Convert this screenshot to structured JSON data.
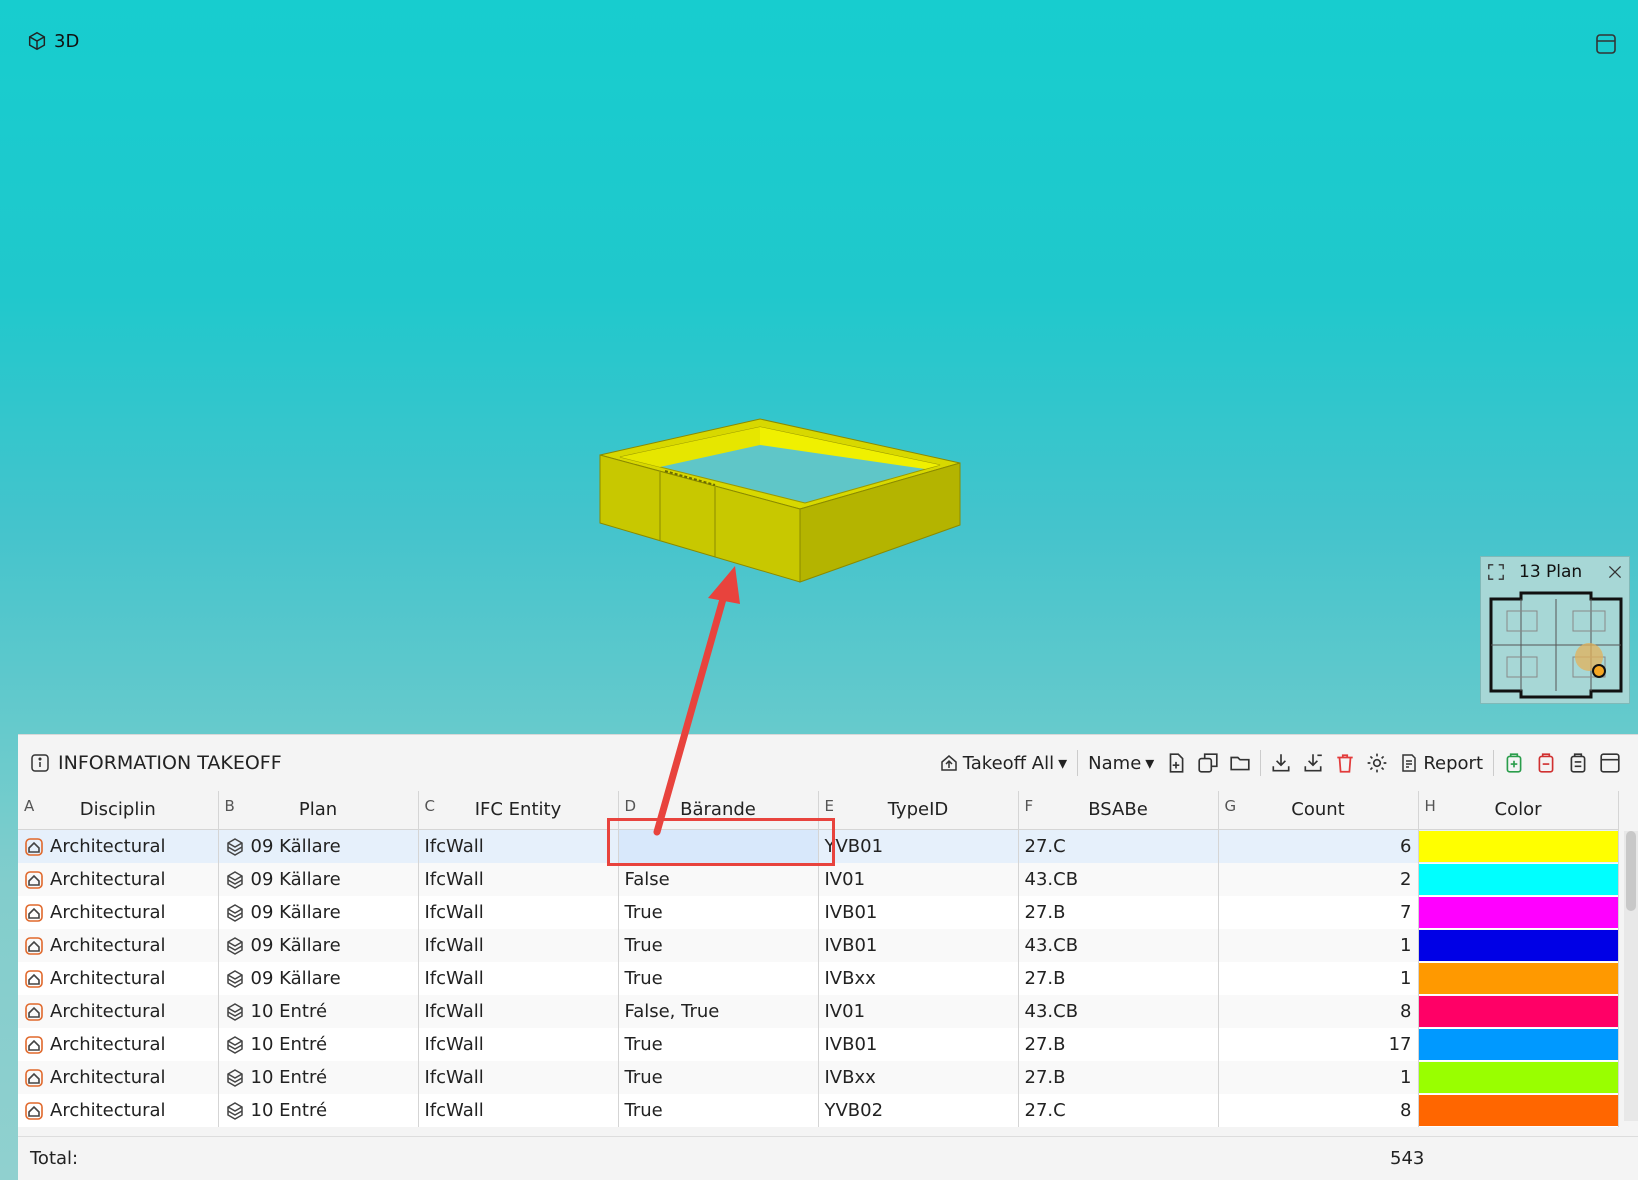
{
  "viewport": {
    "label": "3D",
    "background_top": "#17cdcf",
    "background_bottom": "#90d0cf"
  },
  "minimap": {
    "title": "13 Plan"
  },
  "panel": {
    "title": "INFORMATION TAKEOFF",
    "toolbar": {
      "takeoff_all": "Takeoff All",
      "name": "Name",
      "report": "Report"
    },
    "columns": [
      {
        "letter": "A",
        "label": "Disciplin"
      },
      {
        "letter": "B",
        "label": "Plan"
      },
      {
        "letter": "C",
        "label": "IFC Entity"
      },
      {
        "letter": "D",
        "label": "Bärande"
      },
      {
        "letter": "E",
        "label": "TypeID"
      },
      {
        "letter": "F",
        "label": "BSABe"
      },
      {
        "letter": "G",
        "label": "Count"
      },
      {
        "letter": "H",
        "label": "Color"
      }
    ],
    "rows": [
      {
        "disciplin": "Architectural",
        "plan": "09 Källare",
        "entity": "IfcWall",
        "barande": "",
        "typeid": "YVB01",
        "bsabe": "27.C",
        "count": "6",
        "color": "#ffff00"
      },
      {
        "disciplin": "Architectural",
        "plan": "09 Källare",
        "entity": "IfcWall",
        "barande": "False",
        "typeid": "IV01",
        "bsabe": "43.CB",
        "count": "2",
        "color": "#00ffff"
      },
      {
        "disciplin": "Architectural",
        "plan": "09 Källare",
        "entity": "IfcWall",
        "barande": "True",
        "typeid": "IVB01",
        "bsabe": "27.B",
        "count": "7",
        "color": "#ff00ff"
      },
      {
        "disciplin": "Architectural",
        "plan": "09 Källare",
        "entity": "IfcWall",
        "barande": "True",
        "typeid": "IVB01",
        "bsabe": "43.CB",
        "count": "1",
        "color": "#0000e6"
      },
      {
        "disciplin": "Architectural",
        "plan": "09 Källare",
        "entity": "IfcWall",
        "barande": "True",
        "typeid": "IVBxx",
        "bsabe": "27.B",
        "count": "1",
        "color": "#ff9900"
      },
      {
        "disciplin": "Architectural",
        "plan": "10 Entré",
        "entity": "IfcWall",
        "barande": "False, True",
        "typeid": "IV01",
        "bsabe": "43.CB",
        "count": "8",
        "color": "#ff0066"
      },
      {
        "disciplin": "Architectural",
        "plan": "10 Entré",
        "entity": "IfcWall",
        "barande": "True",
        "typeid": "IVB01",
        "bsabe": "27.B",
        "count": "17",
        "color": "#0099ff"
      },
      {
        "disciplin": "Architectural",
        "plan": "10 Entré",
        "entity": "IfcWall",
        "barande": "True",
        "typeid": "IVBxx",
        "bsabe": "27.B",
        "count": "1",
        "color": "#99ff00"
      },
      {
        "disciplin": "Architectural",
        "plan": "10 Entré",
        "entity": "IfcWall",
        "barande": "True",
        "typeid": "YVB02",
        "bsabe": "27.C",
        "count": "8",
        "color": "#ff6600"
      }
    ],
    "total_label": "Total:",
    "total_value": "543"
  },
  "annotation": {
    "color": "#e8433d"
  }
}
